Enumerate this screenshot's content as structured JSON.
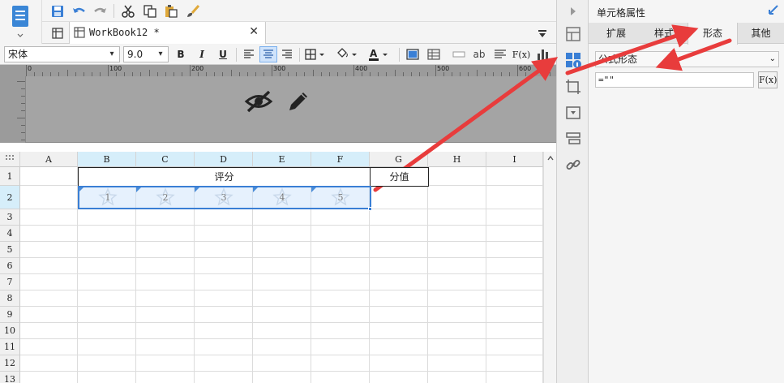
{
  "toolbar": {
    "tab_title": "WorkBook12 *",
    "tab_close": "✕"
  },
  "format": {
    "font_name": "宋体",
    "font_size": "9.0",
    "bold": "B",
    "italic": "I",
    "underline": "U",
    "text_label": "ab",
    "fx_label": "F(x)"
  },
  "ruler": {
    "ticks": [
      "0",
      "100",
      "200",
      "300",
      "400",
      "500",
      "600"
    ]
  },
  "grid": {
    "columns": [
      "A",
      "B",
      "C",
      "D",
      "E",
      "F",
      "G",
      "H",
      "I"
    ],
    "rows": [
      "1",
      "2",
      "3",
      "4",
      "5",
      "6",
      "7",
      "8",
      "9",
      "10",
      "11",
      "12",
      "13"
    ],
    "merged_header": "评分",
    "g1_label": "分值",
    "stars": [
      "1",
      "2",
      "3",
      "4",
      "5"
    ]
  },
  "panel": {
    "title": "单元格属性",
    "tabs": [
      "扩展",
      "样式",
      "形态",
      "其他"
    ],
    "active_tab": "形态",
    "form_type": "公式形态",
    "formula_value": "=\"\"",
    "fx_button": "F(x)"
  },
  "colors": {
    "accent": "#3a7fd5",
    "arrow": "#e83c3c"
  }
}
